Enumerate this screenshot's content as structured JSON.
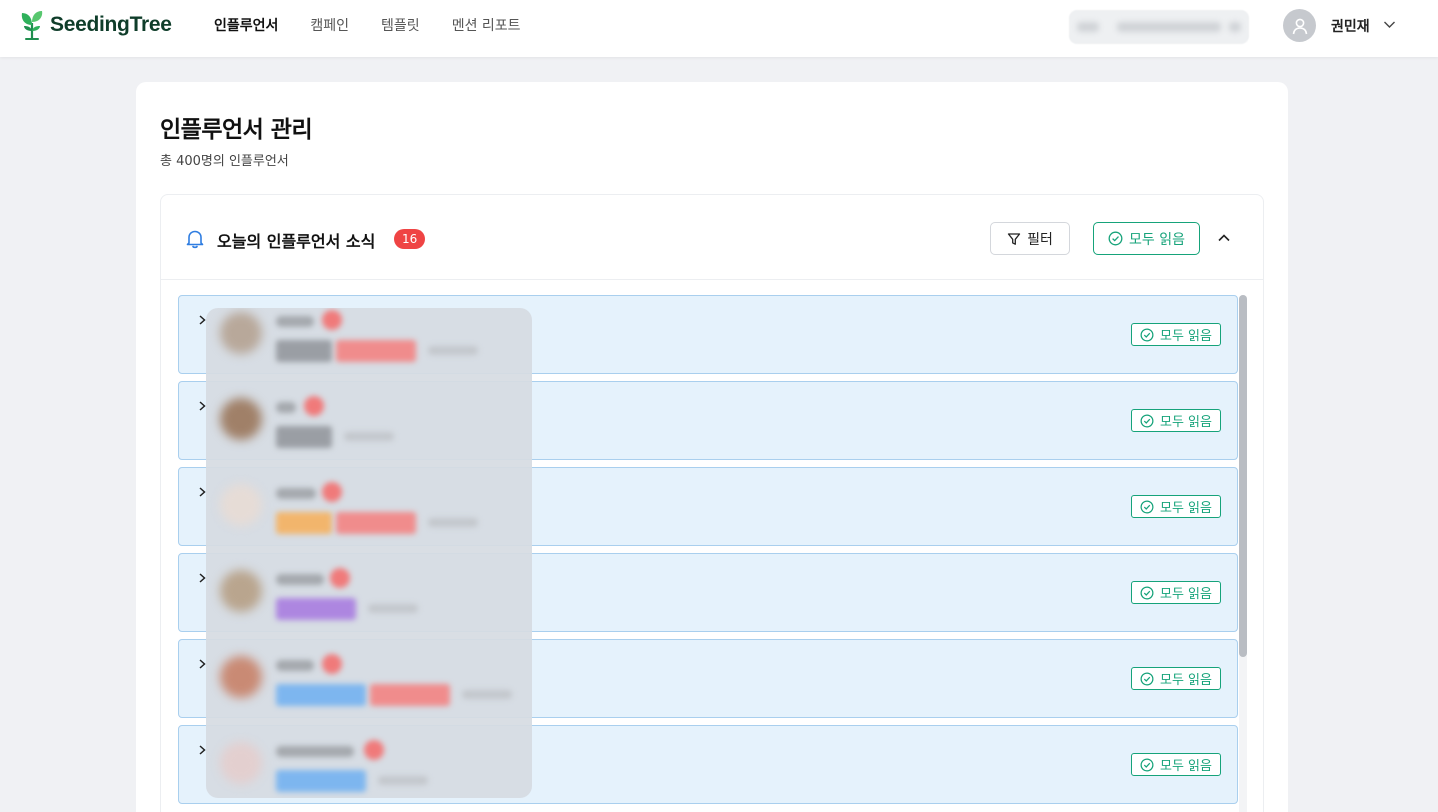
{
  "header": {
    "logo_text": "SeedingTree",
    "nav": [
      "인플루언서",
      "캠페인",
      "템플릿",
      "멘션 리포트"
    ],
    "active_nav": "인플루언서",
    "user_name": "권민재"
  },
  "page": {
    "title": "인플루언서 관리",
    "subtitle": "총 400명의 인플루언서"
  },
  "news": {
    "title": "오늘의 인플루언서 소식",
    "count": "16",
    "filter_label": "필터",
    "read_all_label": "모두 읽음"
  },
  "rows": [
    {
      "read_label": "모두 읽음"
    },
    {
      "read_label": "모두 읽음"
    },
    {
      "read_label": "모두 읽음"
    },
    {
      "read_label": "모두 읽음"
    },
    {
      "read_label": "모두 읽음"
    },
    {
      "read_label": "모두 읽음"
    }
  ],
  "colors": {
    "accent_green": "#16a37a",
    "row_bg": "#e5f2fc",
    "row_border": "#a9cfee",
    "badge_red": "#ef4444",
    "bell_blue": "#2f7de1"
  },
  "icons": [
    "logo-sprout-icon",
    "user-avatar-icon",
    "chevron-down-icon",
    "bell-icon",
    "filter-icon",
    "check-circle-icon",
    "chevron-up-icon",
    "chevron-right-icon"
  ]
}
